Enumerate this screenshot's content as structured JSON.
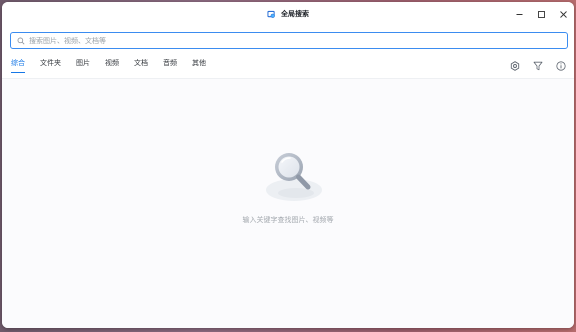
{
  "window": {
    "title": "全局搜索",
    "app_icon": "image-search-app-icon"
  },
  "controls": {
    "minimize_icon": "minimize-icon",
    "maximize_icon": "maximize-icon",
    "close_icon": "close-icon"
  },
  "search": {
    "placeholder": "搜索图片、视频、文档等",
    "value": "",
    "accent_color": "#3b8cf0"
  },
  "tabs": [
    {
      "label": "综合",
      "active": true
    },
    {
      "label": "文件夹",
      "active": false
    },
    {
      "label": "图片",
      "active": false
    },
    {
      "label": "视频",
      "active": false
    },
    {
      "label": "文档",
      "active": false
    },
    {
      "label": "音频",
      "active": false
    },
    {
      "label": "其他",
      "active": false
    }
  ],
  "toolbar": {
    "settings_icon": "gear-icon",
    "filter_icon": "filter-icon",
    "info_icon": "info-icon"
  },
  "empty_state": {
    "icon": "magnifier-illustration",
    "message": "输入关键字查找图片、视频等"
  },
  "colors": {
    "accent": "#1677e6",
    "muted_text": "#a3a8ae"
  }
}
